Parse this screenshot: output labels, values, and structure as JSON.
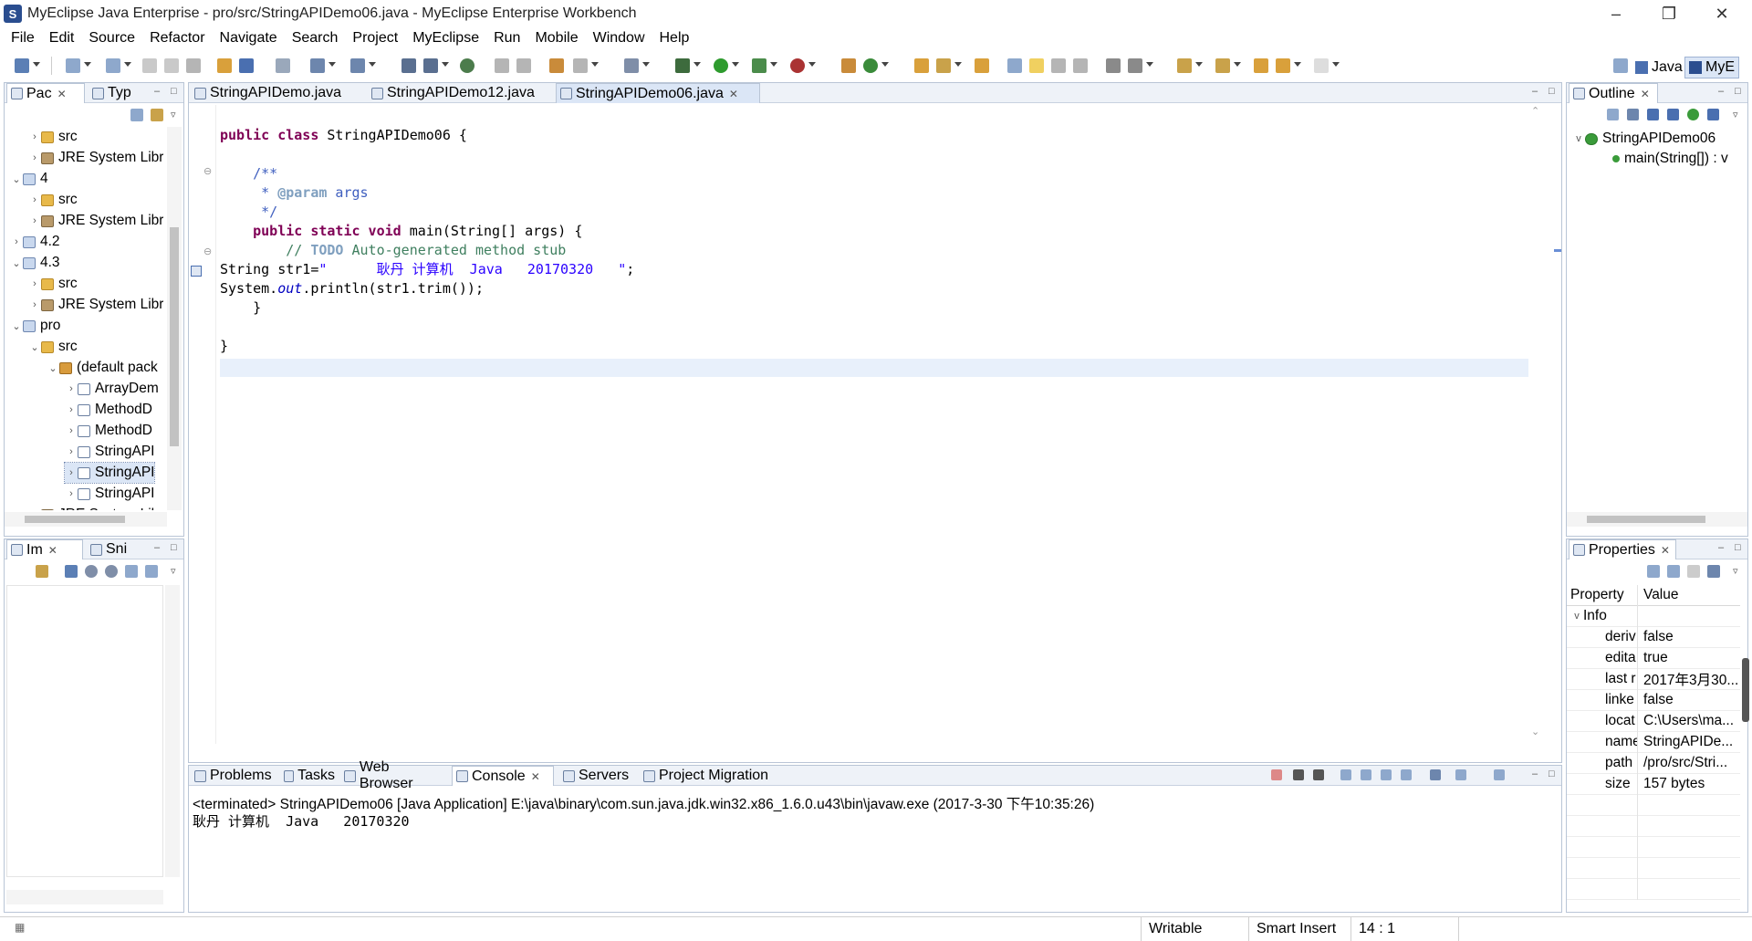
{
  "window": {
    "title": "MyEclipse Java Enterprise - pro/src/StringAPIDemo06.java - MyEclipse Enterprise Workbench"
  },
  "menu": [
    "File",
    "Edit",
    "Source",
    "Refactor",
    "Navigate",
    "Search",
    "Project",
    "MyEclipse",
    "Run",
    "Mobile",
    "Window",
    "Help"
  ],
  "perspectives": {
    "java": "Java",
    "myeclipse": "MyE"
  },
  "explorer": {
    "tabs": [
      "Pac",
      "Typ"
    ],
    "rows": [
      {
        "indent": 1,
        "arrow": ">",
        "icon": "folder",
        "label": "src"
      },
      {
        "indent": 1,
        "arrow": ">",
        "icon": "lib",
        "label": "JRE System Libr"
      },
      {
        "indent": 0,
        "arrow": "v",
        "icon": "proj",
        "label": "4"
      },
      {
        "indent": 1,
        "arrow": ">",
        "icon": "folder",
        "label": "src"
      },
      {
        "indent": 1,
        "arrow": ">",
        "icon": "lib",
        "label": "JRE System Libr"
      },
      {
        "indent": 0,
        "arrow": ">",
        "icon": "proj",
        "label": "4.2"
      },
      {
        "indent": 0,
        "arrow": "v",
        "icon": "proj",
        "label": "4.3"
      },
      {
        "indent": 1,
        "arrow": ">",
        "icon": "folder",
        "label": "src"
      },
      {
        "indent": 1,
        "arrow": ">",
        "icon": "lib",
        "label": "JRE System Libr"
      },
      {
        "indent": 0,
        "arrow": "v",
        "icon": "proj",
        "label": "pro"
      },
      {
        "indent": 1,
        "arrow": "v",
        "icon": "folder",
        "label": "src"
      },
      {
        "indent": 2,
        "arrow": "v",
        "icon": "pkg",
        "label": "(default pack"
      },
      {
        "indent": 3,
        "arrow": ">",
        "icon": "java",
        "label": "ArrayDem"
      },
      {
        "indent": 3,
        "arrow": ">",
        "icon": "java",
        "label": "MethodD"
      },
      {
        "indent": 3,
        "arrow": ">",
        "icon": "java",
        "label": "MethodD"
      },
      {
        "indent": 3,
        "arrow": ">",
        "icon": "java",
        "label": "StringAPI"
      },
      {
        "indent": 3,
        "arrow": ">",
        "icon": "java",
        "label": "StringAPI",
        "selected": true
      },
      {
        "indent": 3,
        "arrow": ">",
        "icon": "java",
        "label": "StringAPI"
      },
      {
        "indent": 1,
        "arrow": ">",
        "icon": "lib",
        "label": "JRE System Lib"
      }
    ]
  },
  "imagePanel": {
    "tabs": [
      "Im",
      "Sni"
    ]
  },
  "editor": {
    "tabs": [
      "StringAPIDemo.java",
      "StringAPIDemo12.java",
      "StringAPIDemo06.java"
    ],
    "lines": {
      "l1a": "public class",
      "l1b": " StringAPIDemo06 {",
      "l2": "    /**",
      "l3a": "     * ",
      "l3b": "@param",
      " l3c": " args",
      "l4": "     */",
      "l5a": "    public static void",
      "l5b": " main(String[] args) {",
      "l6a": "        // ",
      "l6b": "TODO",
      " l6c": " Auto-generated method stub",
      "l7a": "String str1=",
      "l7b": "\"      耿丹 计算机  Java   20170320   \"",
      "l7c": ";",
      "l8a": "System.",
      "l8b": "out",
      "l8c": ".println(str1.trim());",
      "l9": "    }",
      "l10": "}"
    }
  },
  "outline": {
    "tab": "Outline",
    "class": "StringAPIDemo06",
    "method": "main(String[]) : v"
  },
  "properties": {
    "tab": "Properties",
    "headers": [
      "Property",
      "Value"
    ],
    "group": "Info",
    "rows": [
      {
        "k": "deriv",
        "v": "false"
      },
      {
        "k": "edita",
        "v": "true"
      },
      {
        "k": "last r",
        "v": "2017年3月30..."
      },
      {
        "k": "linke",
        "v": "false"
      },
      {
        "k": "locat",
        "v": "C:\\Users\\ma..."
      },
      {
        "k": "name",
        "v": "StringAPIDe..."
      },
      {
        "k": "path",
        "v": "/pro/src/Stri..."
      },
      {
        "k": "size",
        "v": "157  bytes"
      }
    ]
  },
  "bottom": {
    "tabs": [
      "Problems",
      "Tasks",
      "Web Browser",
      "Console",
      "Servers",
      "Project Migration"
    ],
    "terminated": "<terminated> StringAPIDemo06 [Java Application] E:\\java\\binary\\com.sun.java.jdk.win32.x86_1.6.0.u43\\bin\\javaw.exe (2017-3-30 下午10:35:26)",
    "output": "耿丹 计算机  Java   20170320"
  },
  "status": {
    "writable": "Writable",
    "insert": "Smart Insert",
    "position": "14 : 1"
  }
}
